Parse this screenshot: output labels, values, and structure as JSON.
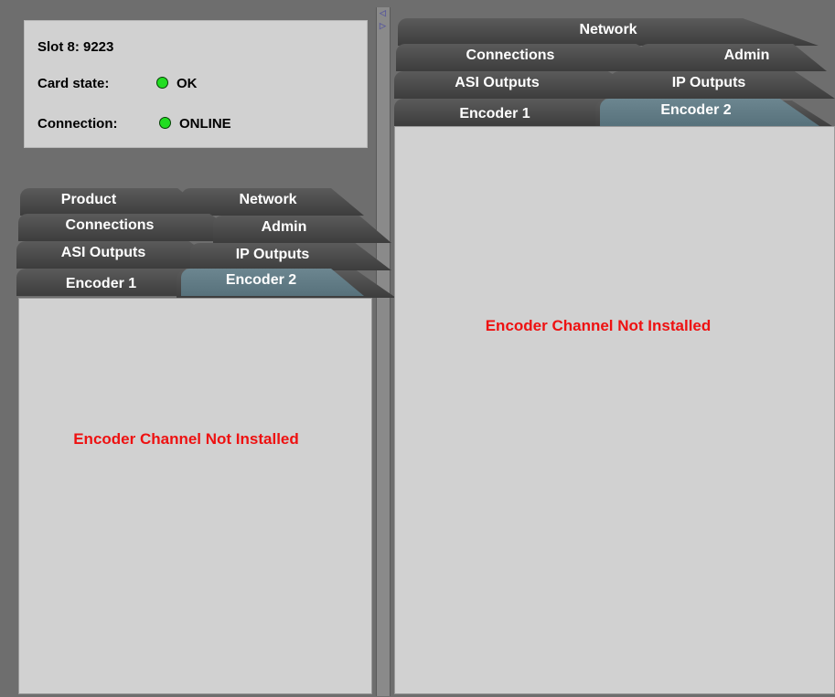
{
  "status": {
    "slot": "Slot 8: 9223",
    "card_state_label": "Card state:",
    "card_state_value": "OK",
    "connection_label": "Connection:",
    "connection_value": "ONLINE",
    "led_color": "#22dd22"
  },
  "left_panel": {
    "tabs": {
      "product": "Product",
      "network": "Network",
      "connections": "Connections",
      "admin": "Admin",
      "asi_outputs": "ASI Outputs",
      "ip_outputs": "IP Outputs",
      "encoder1": "Encoder 1",
      "encoder2": "Encoder 2"
    },
    "selected_tab": "Encoder 2",
    "message": "Encoder Channel Not Installed"
  },
  "right_panel": {
    "tabs": {
      "network": "Network",
      "connections": "Connections",
      "admin": "Admin",
      "asi_outputs": "ASI Outputs",
      "ip_outputs": "IP Outputs",
      "encoder1": "Encoder 1",
      "encoder2": "Encoder 2"
    },
    "selected_tab": "Encoder 2",
    "message": "Encoder Channel Not Installed"
  },
  "divider": {
    "left_arrow": "◁",
    "right_arrow": "▷"
  },
  "colors": {
    "tab_selected": "#5f7b85",
    "error_text": "#ee1111",
    "panel_bg": "#d1d1d1"
  }
}
